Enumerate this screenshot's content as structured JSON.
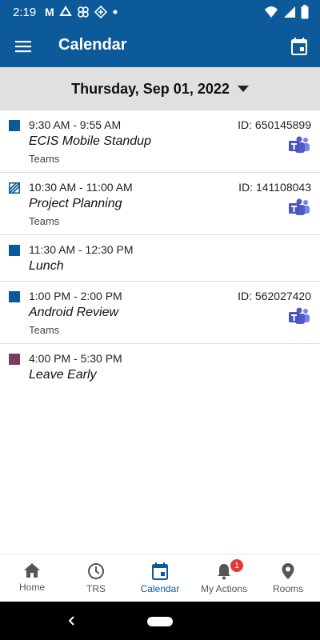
{
  "status_bar": {
    "time": "2:19",
    "left_icons": [
      "gmail-icon",
      "sync-icon",
      "fan-icon",
      "assistant-icon",
      "dot-icon"
    ],
    "right_icons": [
      "wifi-icon",
      "signal-icon",
      "battery-icon"
    ]
  },
  "app_bar": {
    "title": "Calendar",
    "menu_icon": "hamburger-menu-icon",
    "action_icon": "calendar-icon"
  },
  "date_selector": {
    "date": "Thursday, Sep 01, 2022",
    "icon": "dropdown-arrow-icon"
  },
  "events": [
    {
      "time": "9:30 AM - 9:55 AM",
      "title": "ECIS Mobile Standup",
      "subtitle": "Teams",
      "id_label": "ID: 650145899",
      "color": "#0d5a9a",
      "pattern": "solid",
      "teams": true
    },
    {
      "time": "10:30 AM - 11:00 AM",
      "title": "Project Planning",
      "subtitle": "Teams",
      "id_label": "ID: 141108043",
      "color": "#0d5a9a",
      "pattern": "striped",
      "teams": true
    },
    {
      "time": "11:30 AM - 12:30 PM",
      "title": "Lunch",
      "subtitle": "",
      "id_label": "",
      "color": "#0d5a9a",
      "pattern": "solid",
      "teams": false
    },
    {
      "time": "1:00 PM - 2:00 PM",
      "title": "Android Review",
      "subtitle": "Teams",
      "id_label": "ID: 562027420",
      "color": "#0d5a9a",
      "pattern": "solid",
      "teams": true
    },
    {
      "time": "4:00 PM - 5:30 PM",
      "title": "Leave Early",
      "subtitle": "",
      "id_label": "",
      "color": "#7d3c5c",
      "pattern": "solid",
      "teams": false
    }
  ],
  "bottom_nav": {
    "items": [
      {
        "label": "Home",
        "icon": "home-icon",
        "active": false
      },
      {
        "label": "TRS",
        "icon": "clock-icon",
        "active": false
      },
      {
        "label": "Calendar",
        "icon": "calendar-icon",
        "active": true
      },
      {
        "label": "My Actions",
        "icon": "bell-icon",
        "active": false,
        "badge": "1"
      },
      {
        "label": "Rooms",
        "icon": "location-pin-icon",
        "active": false
      }
    ]
  },
  "colors": {
    "primary": "#0d5a9a",
    "date_bar_bg": "#e0e0e0",
    "teams_purple": "#5059c9",
    "badge_red": "#e53935"
  }
}
